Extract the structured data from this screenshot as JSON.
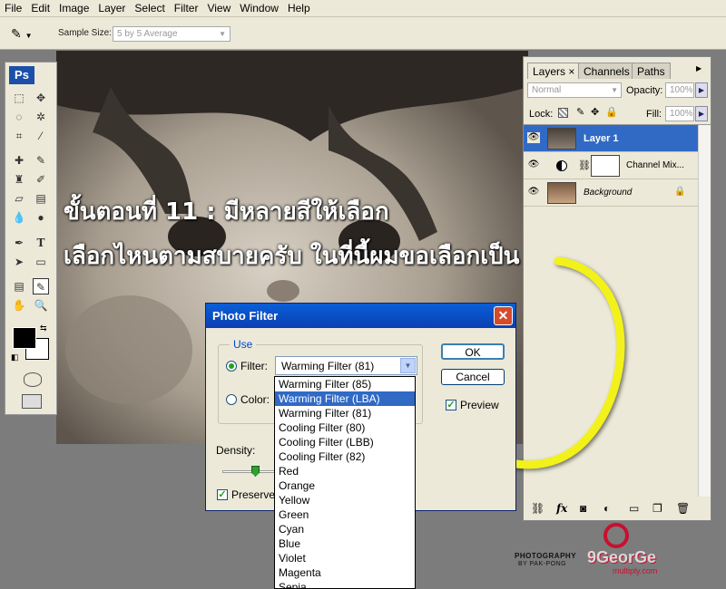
{
  "menu": [
    "File",
    "Edit",
    "Image",
    "Layer",
    "Select",
    "Filter",
    "View",
    "Window",
    "Help"
  ],
  "options_bar": {
    "sample_size_label": "Sample Size:",
    "sample_size_value": "5 by 5 Average"
  },
  "toolbox": {
    "logo": "Ps"
  },
  "overlay": {
    "line1": "ขั้นตอนที่ 11 : มีหลายสีให้เลือก",
    "line2": "เลือกไหนตามสบายครับ  ในที่นี้ผมขอเลือกเป็น LBA"
  },
  "layers_panel": {
    "tabs": [
      "Layers",
      "Channels",
      "Paths"
    ],
    "blend_mode": "Normal",
    "opacity_label": "Opacity:",
    "opacity_value": "100%",
    "lock_label": "Lock:",
    "fill_label": "Fill:",
    "fill_value": "100%",
    "layers": [
      {
        "name": "Layer 1",
        "selected": true
      },
      {
        "name": "Channel Mix...",
        "selected": false
      },
      {
        "name": "Background",
        "selected": false
      }
    ],
    "footer_icons": [
      "link-icon",
      "fx-icon",
      "mask-icon",
      "adjustment-icon",
      "folder-icon",
      "new-layer-icon",
      "trash-icon"
    ]
  },
  "photo_filter_dialog": {
    "title": "Photo Filter",
    "use_label": "Use",
    "filter_label": "Filter:",
    "filter_value": "Warming Filter (81)",
    "color_label": "Color:",
    "ok_label": "OK",
    "cancel_label": "Cancel",
    "preview_label": "Preview",
    "density_label": "Density:",
    "preserve_label": "Preserve",
    "density_value": 0.3
  },
  "filter_options": [
    "Warming Filter (85)",
    "Warming Filter (LBA)",
    "Warming Filter (81)",
    "Cooling Filter (80)",
    "Cooling Filter (LBB)",
    "Cooling Filter (82)",
    "Red",
    "Orange",
    "Yellow",
    "Green",
    "Cyan",
    "Blue",
    "Violet",
    "Magenta",
    "Sepia"
  ],
  "highlighted_option": "Warming Filter (LBA)",
  "watermark": {
    "left_line1": "PHOTOGRAPHY",
    "left_line2": "BY PAK-PONG",
    "brand": "9GeorGe",
    "brand_sub": "multiply.com"
  },
  "colors": {
    "accent": "#316ac5",
    "title_bar": "#0a5fd8",
    "arrow": "#f2f21a"
  }
}
